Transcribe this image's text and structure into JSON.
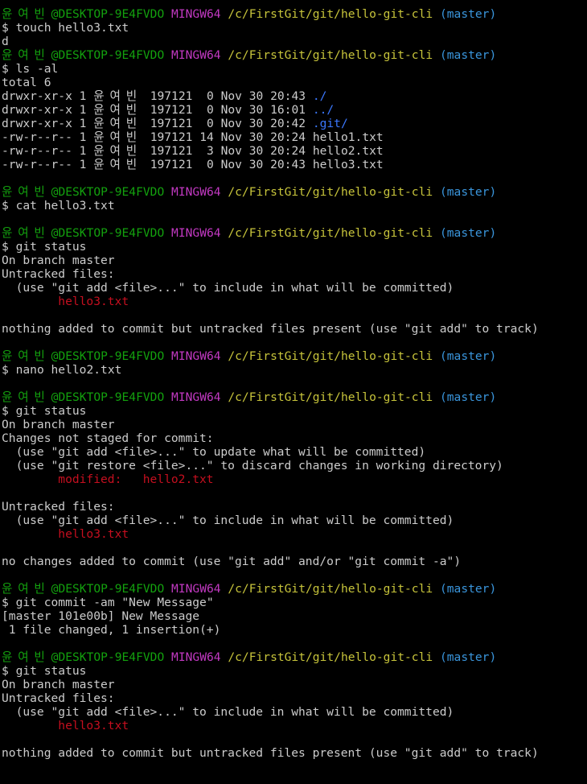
{
  "window": {
    "background": "#000000",
    "foreground": "#cccccc"
  },
  "prompt": {
    "user": "윤 여 빈",
    "host": "@DESKTOP-9E4FVDO",
    "env": "MINGW64",
    "path": "/c/FirstGit/git/hello-git-cli",
    "branch": "(master)",
    "symbol": "$",
    "colors": {
      "user": "#13a10e",
      "env": "#c239c2",
      "path": "#c7c43b",
      "branch": "#3a96dd"
    }
  },
  "lines": [
    {
      "type": "prompt"
    },
    {
      "type": "cmd",
      "text": "touch hello3.txt"
    },
    {
      "type": "out",
      "text": "d"
    },
    {
      "type": "prompt"
    },
    {
      "type": "cmd",
      "text": "ls -al"
    },
    {
      "type": "out",
      "text": "total 6"
    },
    {
      "type": "ls",
      "perm": "drwxr-xr-x",
      "links": "1",
      "owner": "윤 여 빈",
      "group": "197121",
      "size": " 0",
      "date": "Nov 30 20:43",
      "name": "./",
      "color": "blue"
    },
    {
      "type": "ls",
      "perm": "drwxr-xr-x",
      "links": "1",
      "owner": "윤 여 빈",
      "group": "197121",
      "size": " 0",
      "date": "Nov 30 16:01",
      "name": "../",
      "color": "blue"
    },
    {
      "type": "ls",
      "perm": "drwxr-xr-x",
      "links": "1",
      "owner": "윤 여 빈",
      "group": "197121",
      "size": " 0",
      "date": "Nov 30 20:42",
      "name": ".git/",
      "color": "blue"
    },
    {
      "type": "ls",
      "perm": "-rw-r--r--",
      "links": "1",
      "owner": "윤 여 빈",
      "group": "197121",
      "size": "14",
      "date": "Nov 30 20:24",
      "name": "hello1.txt",
      "color": "plain"
    },
    {
      "type": "ls",
      "perm": "-rw-r--r--",
      "links": "1",
      "owner": "윤 여 빈",
      "group": "197121",
      "size": " 3",
      "date": "Nov 30 20:24",
      "name": "hello2.txt",
      "color": "plain"
    },
    {
      "type": "ls",
      "perm": "-rw-r--r--",
      "links": "1",
      "owner": "윤 여 빈",
      "group": "197121",
      "size": " 0",
      "date": "Nov 30 20:43",
      "name": "hello3.txt",
      "color": "plain"
    },
    {
      "type": "blank"
    },
    {
      "type": "prompt"
    },
    {
      "type": "cmd",
      "text": "cat hello3.txt"
    },
    {
      "type": "blank"
    },
    {
      "type": "prompt"
    },
    {
      "type": "cmd",
      "text": "git status"
    },
    {
      "type": "out",
      "text": "On branch master"
    },
    {
      "type": "out",
      "text": "Untracked files:"
    },
    {
      "type": "out",
      "text": "  (use \"git add <file>...\" to include in what will be committed)"
    },
    {
      "type": "red",
      "text": "        hello3.txt"
    },
    {
      "type": "blank"
    },
    {
      "type": "out",
      "text": "nothing added to commit but untracked files present (use \"git add\" to track)"
    },
    {
      "type": "blank"
    },
    {
      "type": "prompt"
    },
    {
      "type": "cmd",
      "text": "nano hello2.txt"
    },
    {
      "type": "blank"
    },
    {
      "type": "prompt"
    },
    {
      "type": "cmd",
      "text": "git status"
    },
    {
      "type": "out",
      "text": "On branch master"
    },
    {
      "type": "out",
      "text": "Changes not staged for commit:"
    },
    {
      "type": "out",
      "text": "  (use \"git add <file>...\" to update what will be committed)"
    },
    {
      "type": "out",
      "text": "  (use \"git restore <file>...\" to discard changes in working directory)"
    },
    {
      "type": "red",
      "text": "        modified:   hello2.txt"
    },
    {
      "type": "blank"
    },
    {
      "type": "out",
      "text": "Untracked files:"
    },
    {
      "type": "out",
      "text": "  (use \"git add <file>...\" to include in what will be committed)"
    },
    {
      "type": "red",
      "text": "        hello3.txt"
    },
    {
      "type": "blank"
    },
    {
      "type": "out",
      "text": "no changes added to commit (use \"git add\" and/or \"git commit -a\")"
    },
    {
      "type": "blank"
    },
    {
      "type": "prompt"
    },
    {
      "type": "cmd",
      "text": "git commit -am \"New Message\""
    },
    {
      "type": "out",
      "text": "[master 101e00b] New Message"
    },
    {
      "type": "out",
      "text": " 1 file changed, 1 insertion(+)"
    },
    {
      "type": "blank"
    },
    {
      "type": "prompt"
    },
    {
      "type": "cmd",
      "text": "git status"
    },
    {
      "type": "out",
      "text": "On branch master"
    },
    {
      "type": "out",
      "text": "Untracked files:"
    },
    {
      "type": "out",
      "text": "  (use \"git add <file>...\" to include in what will be committed)"
    },
    {
      "type": "red",
      "text": "        hello3.txt"
    },
    {
      "type": "blank"
    },
    {
      "type": "out",
      "text": "nothing added to commit but untracked files present (use \"git add\" to track)"
    }
  ]
}
